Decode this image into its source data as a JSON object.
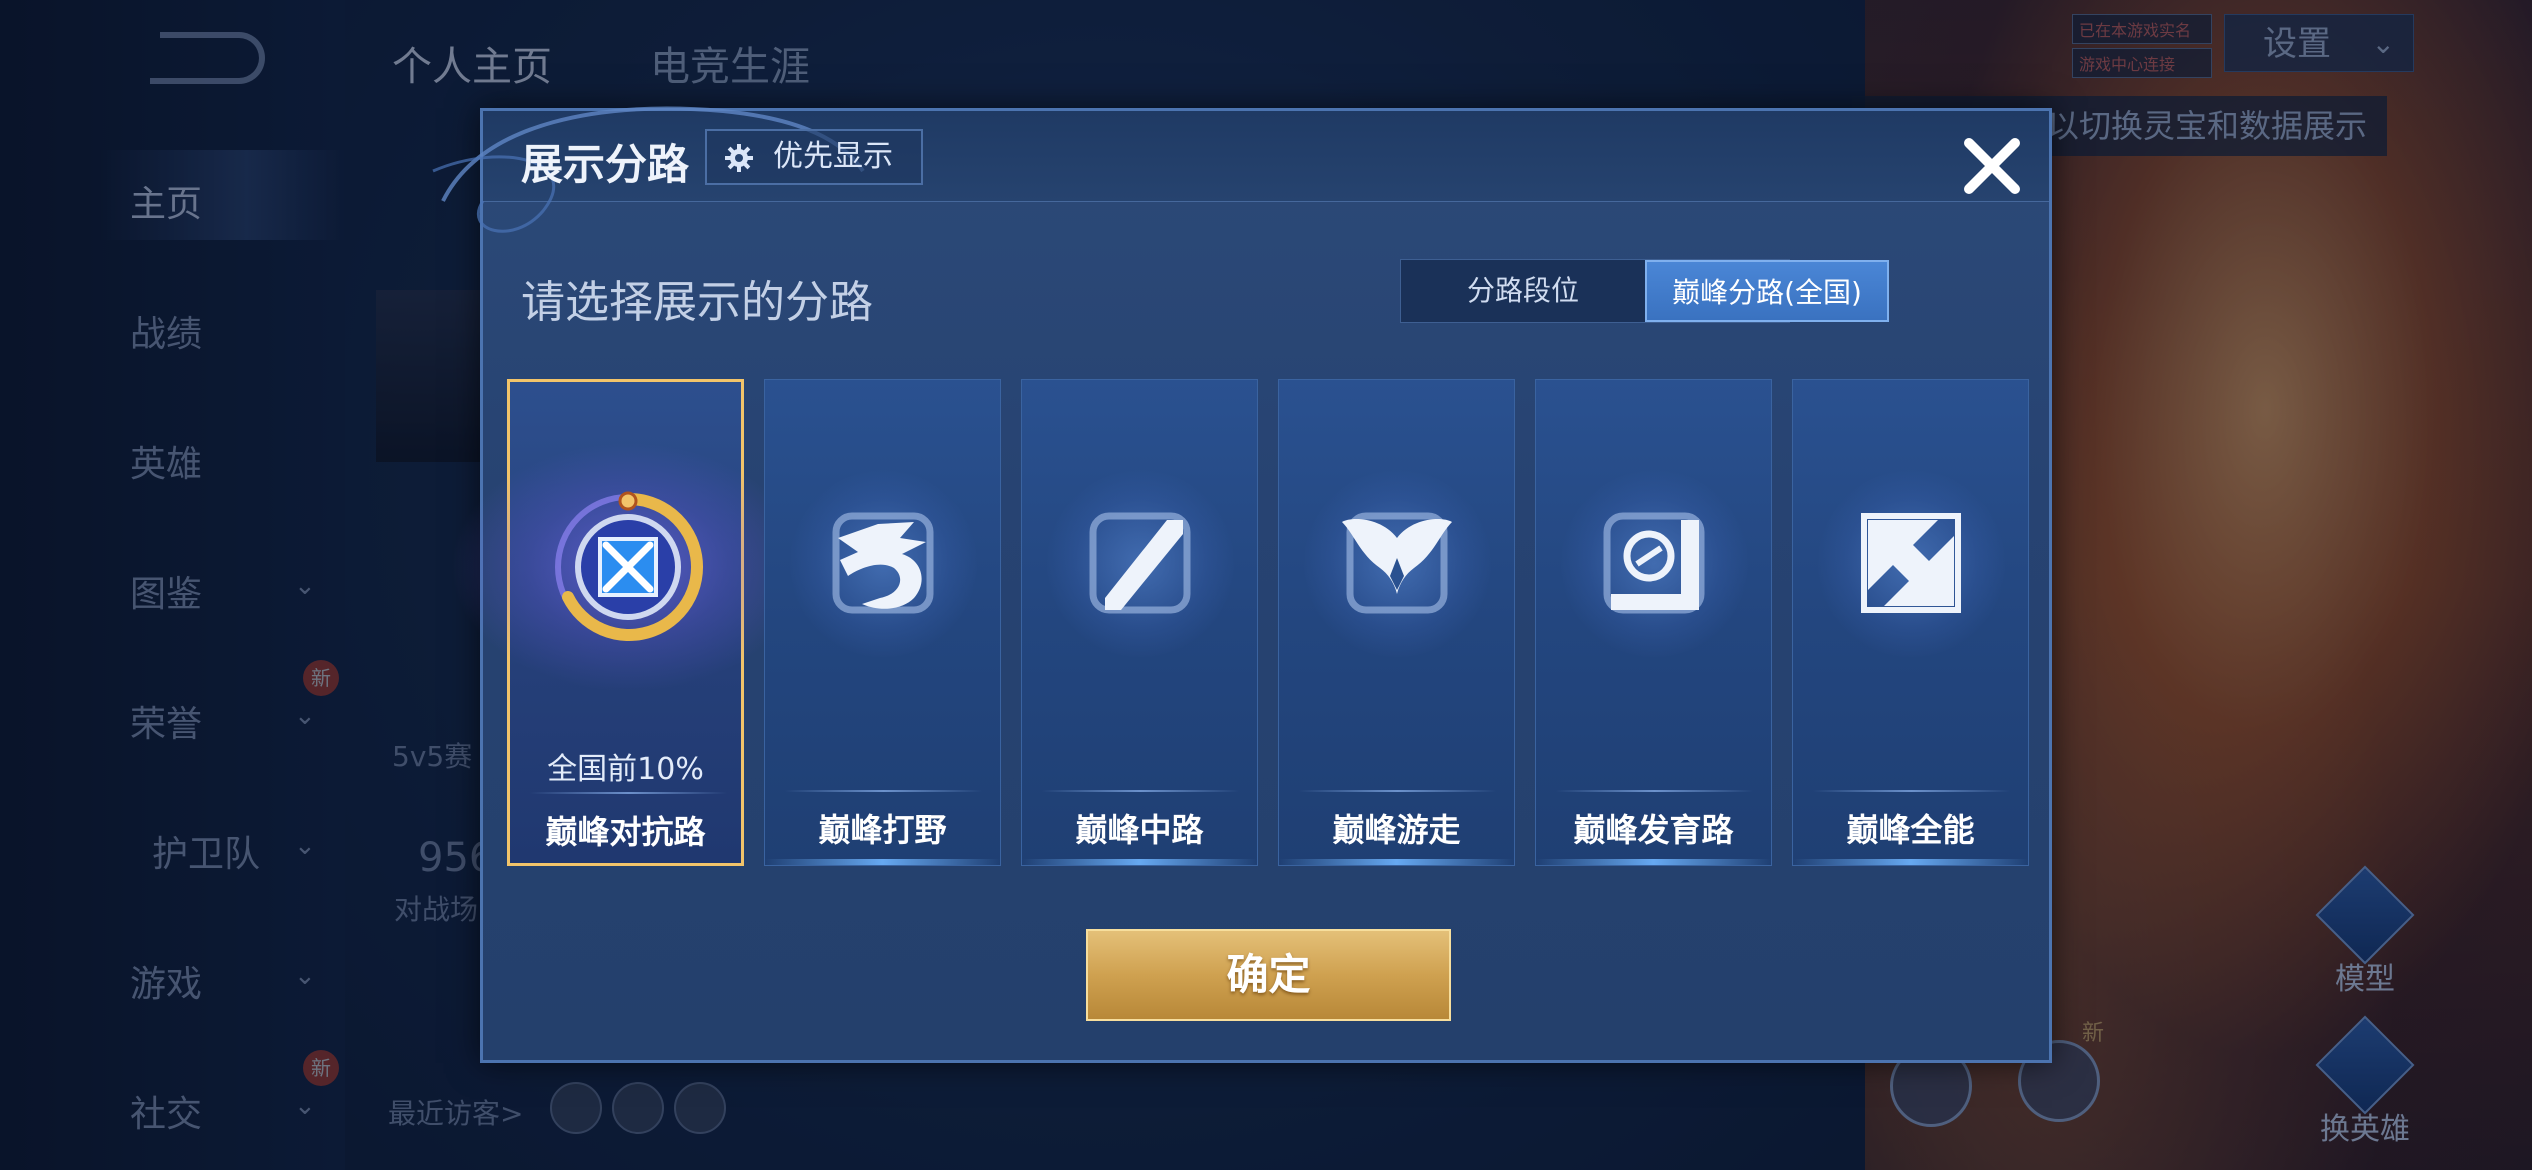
{
  "background": {
    "top_tabs": [
      "个人主页",
      "电竞生涯"
    ],
    "nav_items": [
      {
        "label": "主页",
        "chevron": false,
        "badge": ""
      },
      {
        "label": "战绩",
        "chevron": false,
        "badge": ""
      },
      {
        "label": "英雄",
        "chevron": false,
        "badge": ""
      },
      {
        "label": "图鉴",
        "chevron": true,
        "badge": ""
      },
      {
        "label": "荣誉",
        "chevron": true,
        "badge": "新"
      },
      {
        "label": "护卫队",
        "chevron": true,
        "badge": ""
      },
      {
        "label": "游戏",
        "chevron": true,
        "badge": ""
      },
      {
        "label": "社交",
        "chevron": true,
        "badge": "新"
      }
    ],
    "settings_label": "设置",
    "small_tags": [
      "已在本游戏实名",
      "游戏中心连接"
    ],
    "right_hint": "以切换灵宝和数据展示",
    "profile_mode": "5v5赛",
    "match_count": "956",
    "match_label": "对战场",
    "recent_visitors_label": "最近访客>",
    "model_label": "模型",
    "switch_hero_label": "换英雄",
    "new_label": "新"
  },
  "modal": {
    "title": "展示分路",
    "priority_button": "优先显示",
    "subtitle": "请选择展示的分路",
    "toggle": {
      "options": [
        "分路段位",
        "巅峰分路(全国)"
      ],
      "selected": "巅峰分路(全国)"
    },
    "lanes": [
      {
        "name": "巅峰对抗路",
        "rank": "全国前10%",
        "selected": true,
        "icon": "sword-shield-emblem-icon"
      },
      {
        "name": "巅峰打野",
        "rank": "",
        "selected": false,
        "icon": "dragon-icon"
      },
      {
        "name": "巅峰中路",
        "rank": "",
        "selected": false,
        "icon": "slash-square-icon"
      },
      {
        "name": "巅峰游走",
        "rank": "",
        "selected": false,
        "icon": "wings-icon"
      },
      {
        "name": "巅峰发育路",
        "rank": "",
        "selected": false,
        "icon": "target-square-icon"
      },
      {
        "name": "巅峰全能",
        "rank": "",
        "selected": false,
        "icon": "diamond-square-icon"
      }
    ],
    "confirm_button": "确定"
  },
  "colors": {
    "accent_gold": "#f2c46a",
    "toggle_active": "#4a86d6",
    "modal_bg": "#274372"
  }
}
